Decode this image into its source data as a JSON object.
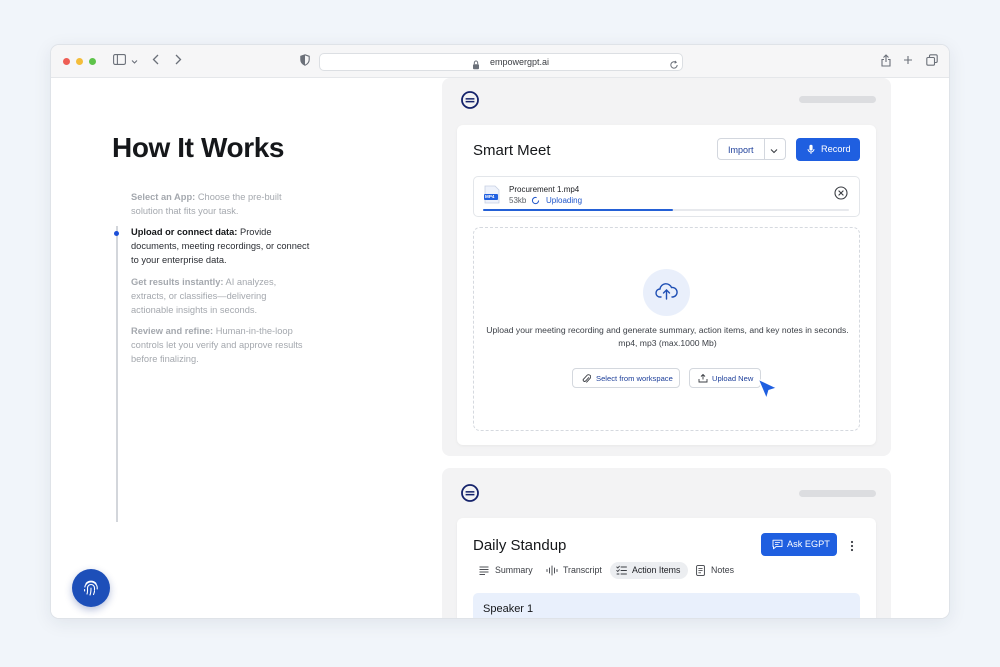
{
  "browser": {
    "url": "empowergpt.ai",
    "traffic_lights": [
      "#ee5e55",
      "#f4bd3a",
      "#5ec34a"
    ]
  },
  "how_it_works": {
    "title": "How It Works",
    "steps": [
      {
        "label": "Select an App:",
        "text": " Choose the pre-built solution that fits your task.",
        "active": false
      },
      {
        "label": "Upload or connect data:",
        "text": " Provide documents, meeting recordings, or connect to your enterprise data.",
        "active": true
      },
      {
        "label": "Get results instantly:",
        "text": " AI analyzes, extracts, or classifies—delivering actionable insights in seconds.",
        "active": false
      },
      {
        "label": "Review and refine:",
        "text": " Human-in-the-loop controls let you verify and approve results before finalizing.",
        "active": false
      }
    ]
  },
  "smart_meet": {
    "title": "Smart Meet",
    "import_label": "Import",
    "record_label": "Record",
    "file": {
      "type_badge": "MP4",
      "name": "Procurement 1.mp4",
      "size": "53kb",
      "status": "Uploading",
      "progress": 0.52
    },
    "dropzone": {
      "description": "Upload your meeting recording and generate summary, action items, and key notes in seconds.",
      "formats": "mp4, mp3 (max.1000 Mb)",
      "select_label": "Select from workspace",
      "upload_label": "Upload New"
    }
  },
  "daily_standup": {
    "title": "Daily Standup",
    "ask_label": "Ask EGPT",
    "tabs": [
      {
        "label": "Summary",
        "icon": "lines-icon",
        "selected": false
      },
      {
        "label": "Transcript",
        "icon": "waveform-icon",
        "selected": false
      },
      {
        "label": "Action Items",
        "icon": "checklist-icon",
        "selected": true
      },
      {
        "label": "Notes",
        "icon": "note-icon",
        "selected": false
      }
    ],
    "speaker": "Speaker 1"
  },
  "colors": {
    "accent": "#1f5fe0",
    "brand_dark": "#1d4fb9",
    "panel_bg": "#f3f3f4"
  }
}
